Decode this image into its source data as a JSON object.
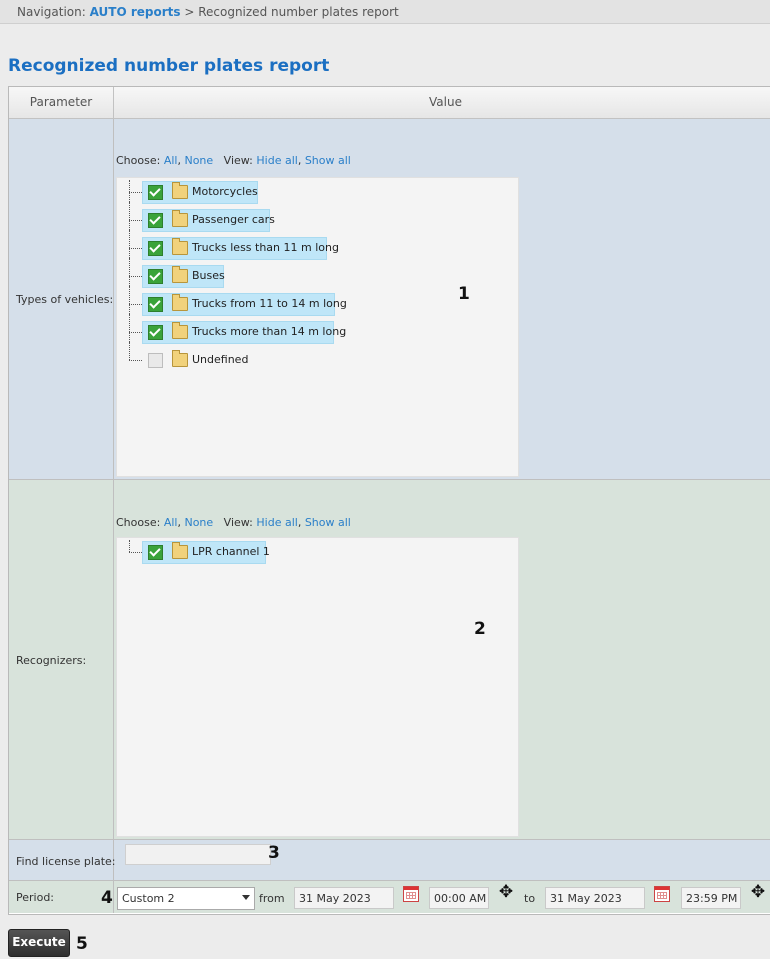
{
  "nav": {
    "prefix": "Navigation: ",
    "link": "AUTO reports",
    "sep": " > ",
    "current": "Recognized number plates report"
  },
  "title": "Recognized number plates report",
  "headers": {
    "parameter": "Parameter",
    "value": "Value"
  },
  "vehicles": {
    "label": "Types of vehicles:",
    "choose": "Choose:",
    "all": "All",
    "none": "None",
    "view": "View:",
    "hide_all": "Hide all",
    "show_all": "Show all",
    "items": [
      {
        "label": "Motorcycles",
        "checked": true
      },
      {
        "label": "Passenger cars",
        "checked": true
      },
      {
        "label": "Trucks less than 11 m long",
        "checked": true
      },
      {
        "label": "Buses",
        "checked": true
      },
      {
        "label": "Trucks from 11 to 14 m long",
        "checked": true
      },
      {
        "label": "Trucks more than 14 m long",
        "checked": true
      },
      {
        "label": "Undefined",
        "checked": false
      }
    ]
  },
  "recognizers": {
    "label": "Recognizers:",
    "choose": "Choose:",
    "all": "All",
    "none": "None",
    "view": "View:",
    "hide_all": "Hide all",
    "show_all": "Show all",
    "items": [
      {
        "label": "LPR channel 1",
        "checked": true
      }
    ]
  },
  "plate": {
    "label": "Find license plate:",
    "value": ""
  },
  "period": {
    "label": "Period:",
    "selected": "Custom 2",
    "from_label": "from",
    "from_date": "31 May 2023",
    "from_time": "00:00 AM",
    "to_label": "to",
    "to_date": "31 May 2023",
    "to_time": "23:59 PM"
  },
  "execute": "Execute",
  "markers": [
    "1",
    "2",
    "3",
    "4",
    "5"
  ]
}
